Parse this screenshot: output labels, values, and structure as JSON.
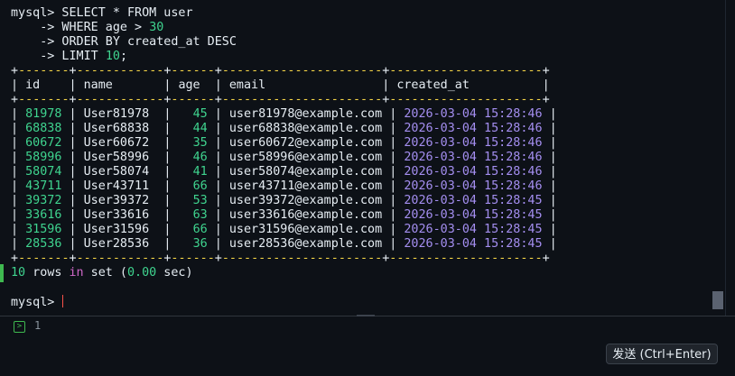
{
  "terminal": {
    "query": [
      {
        "parts": [
          {
            "text": "mysql> SELECT * FROM user"
          }
        ]
      },
      {
        "parts": [
          {
            "text": "    -> WHERE age > "
          },
          {
            "text": "30",
            "cls": "c-num"
          }
        ]
      },
      {
        "parts": [
          {
            "text": "    -> ORDER BY created_at DESC"
          }
        ]
      },
      {
        "parts": [
          {
            "text": "    -> LIMIT "
          },
          {
            "text": "10",
            "cls": "c-num"
          },
          {
            "text": ";"
          }
        ]
      }
    ],
    "table": {
      "border": "+-------+------------+------+----------------------+---------------------+",
      "headers": [
        "id",
        "name",
        "age",
        "email",
        "created_at"
      ],
      "rows": [
        [
          "81978",
          "User81978",
          "45",
          "user81978@example.com",
          "2026-03-04 15:28:46"
        ],
        [
          "68838",
          "User68838",
          "44",
          "user68838@example.com",
          "2026-03-04 15:28:46"
        ],
        [
          "60672",
          "User60672",
          "35",
          "user60672@example.com",
          "2026-03-04 15:28:46"
        ],
        [
          "58996",
          "User58996",
          "46",
          "user58996@example.com",
          "2026-03-04 15:28:46"
        ],
        [
          "58074",
          "User58074",
          "41",
          "user58074@example.com",
          "2026-03-04 15:28:46"
        ],
        [
          "43711",
          "User43711",
          "66",
          "user43711@example.com",
          "2026-03-04 15:28:46"
        ],
        [
          "39372",
          "User39372",
          "53",
          "user39372@example.com",
          "2026-03-04 15:28:45"
        ],
        [
          "33616",
          "User33616",
          "63",
          "user33616@example.com",
          "2026-03-04 15:28:45"
        ],
        [
          "31596",
          "User31596",
          "66",
          "user31596@example.com",
          "2026-03-04 15:28:45"
        ],
        [
          "28536",
          "User28536",
          "36",
          "user28536@example.com",
          "2026-03-04 15:28:45"
        ]
      ]
    },
    "result_summary": {
      "parts": [
        {
          "text": "10",
          "cls": "c-num"
        },
        {
          "text": " rows "
        },
        {
          "text": "in",
          "cls": "c-kw"
        },
        {
          "text": " set ("
        },
        {
          "text": "0.00",
          "cls": "c-num"
        },
        {
          "text": " sec)"
        }
      ]
    },
    "prompt": "mysql> "
  },
  "input": {
    "line_number": "1",
    "prompt_icon": "terminal-prompt-icon",
    "send_label": "发送 (Ctrl+Enter)"
  },
  "colors": {
    "background": "#0d1117",
    "number": "#3fd48f",
    "datetime": "#a48ef0",
    "border_dash": "#f5d547",
    "keyword": "#d068c8",
    "cursor": "#f85149",
    "active_bar": "#3fb950"
  }
}
